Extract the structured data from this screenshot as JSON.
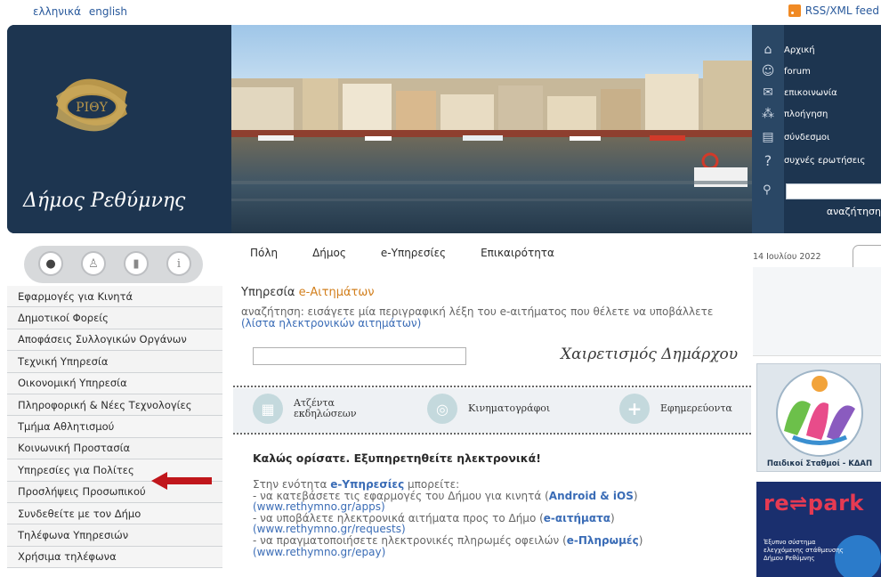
{
  "topbar": {
    "languages": [
      "ελληνικά",
      "english"
    ],
    "rss_label": "RSS/XML feed"
  },
  "header": {
    "logo_text": "Δήμος Ρεθύμνης",
    "logo_emblem": "ΡΙΘΥ",
    "quick_nav": [
      {
        "icon": "home-icon",
        "label": "Αρχική"
      },
      {
        "icon": "people-icon",
        "label": "forum"
      },
      {
        "icon": "mail-icon",
        "label": "επικοινωνία"
      },
      {
        "icon": "sitemap-icon",
        "label": "πλοήγηση"
      },
      {
        "icon": "document-icon",
        "label": "σύνδεσμοι"
      },
      {
        "icon": "question-icon",
        "label": "συχνές ερωτήσεις"
      }
    ],
    "search_label": "αναζήτηση"
  },
  "sidebar": {
    "menu": [
      "Εφαρμογές για Κινητά",
      "Δημοτικοί Φορείς",
      "Αποφάσεις Συλλογικών Οργάνων",
      "Τεχνική Υπηρεσία",
      "Οικονομική Υπηρεσία",
      "Πληροφορική & Νέες Τεχνολογίες",
      "Τμήμα Αθλητισμού",
      "Κοινωνική Προστασία",
      "Υπηρεσίες για Πολίτες",
      "Προσλήψεις Προσωπικού",
      "Συνδεθείτε με τον Δήμο",
      "Τηλέφωνα Υπηρεσιών",
      "Χρήσιμα τηλέφωνα"
    ]
  },
  "nav": {
    "tabs": [
      "Πόλη",
      "Δήμος",
      "e-Υπηρεσίες",
      "Επικαιρότητα"
    ],
    "date": "14 Ιουλίου 2022"
  },
  "main": {
    "service_title_prefix": "Υπηρεσία ",
    "service_title_highlight": "e-Αιτημάτων",
    "service_desc": "αναζήτηση: εισάγετε μία περιγραφική λέξη του e-αιτήματος που θέλετε να υποβάλλετε",
    "service_list_link": "(λίστα ηλεκτρονικών αιτημάτων)",
    "mayor_greeting": "Χαιρετισμός Δημάρχου",
    "quick_links": [
      {
        "icon": "calendar-icon",
        "label1": "Ατζέντα",
        "label2": "εκδηλώσεων"
      },
      {
        "icon": "film-icon",
        "label1": "Κινηματογράφοι",
        "label2": ""
      },
      {
        "icon": "cross-icon",
        "label1": "Εφημερεύοντα",
        "label2": ""
      }
    ],
    "welcome": "Καλώς ορίσατε. Εξυπηρετηθείτε ηλεκτρονικά!",
    "body": {
      "intro_a": "Στην ενότητα ",
      "intro_b": "e-Υπηρεσίες",
      "intro_c": " μπορείτε:",
      "l1_a": "- να κατεβάσετε τις εφαρμογές του Δήμου για κινητά (",
      "l1_b": "Android & iOS",
      "l1_c": ")",
      "l1_url": "(www.rethymno.gr/apps)",
      "l2_a": "- να υποβάλετε ηλεκτρονικά αιτήματα προς το Δήμο (",
      "l2_b": "e-αιτήματα",
      "l2_c": ")",
      "l2_url": "(www.rethymno.gr/requests)",
      "l3_a": "- να πραγματοποιήσετε ηλεκτρονικές πληρωμές οφειλών (",
      "l3_b": "e-Πληρωμές",
      "l3_c": ")",
      "l3_url": "(www.rethymno.gr/epay)"
    }
  },
  "right": {
    "banner1_label": "Παιδικοί Σταθμοί - ΚΔΑΠ",
    "banner2_title": "re⇌park",
    "banner2_text": "Έξυπνο σύστημα ελεγχόμενης στάθμευσης Δήμου Ρεθύμνης"
  },
  "colors": {
    "header_bg": "#1d3550",
    "accent_orange": "#d27f1d",
    "link_blue": "#3a6cb6",
    "arrow_red": "#c0161b"
  }
}
